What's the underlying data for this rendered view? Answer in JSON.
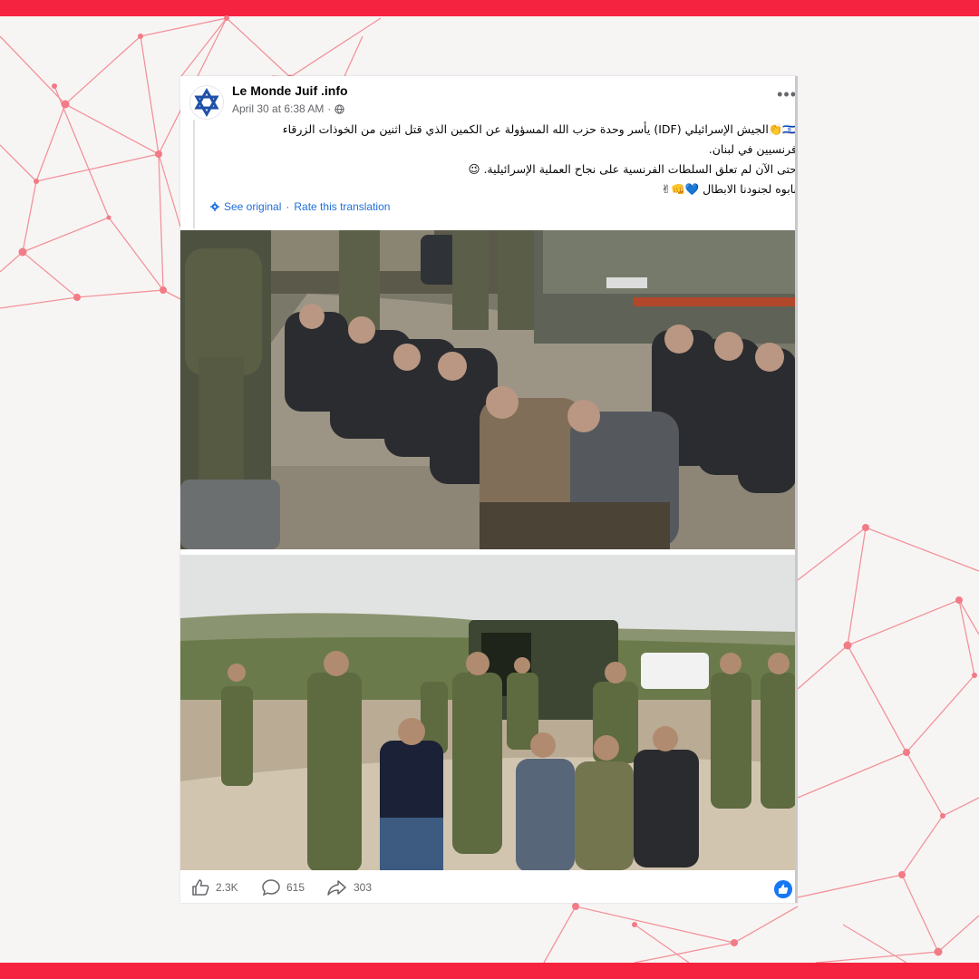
{
  "colors": {
    "accent_bar": "#f5233f",
    "network": "#f27b86",
    "link": "#216fdb"
  },
  "post": {
    "page_name": "Le Monde Juif .info",
    "timestamp": "April 30 at 6:38 AM",
    "timestamp_sep": "·",
    "avatar_icon": "star-of-david-icon",
    "more_label": "•••",
    "text_lines": [
      "🇮🇱👏الجيش الإسرائيلي (IDF) يأسر وحدة حزب الله المسؤولة عن الكمين الذي قتل اثنين من الخوذات الزرقاء",
      "فرنسيين في لبنان.",
      "حتى الآن لم تعلق السلطات الفرنسية على نجاح العملية الإسرائيلية. 😉",
      "نابوه لجنودنا الابطال 💙👊✌"
    ],
    "see_original": "See original",
    "translation_sep": "·",
    "rate_translation": "Rate this translation"
  },
  "actions": {
    "likes": "2.3K",
    "comments": "615",
    "shares": "303"
  }
}
